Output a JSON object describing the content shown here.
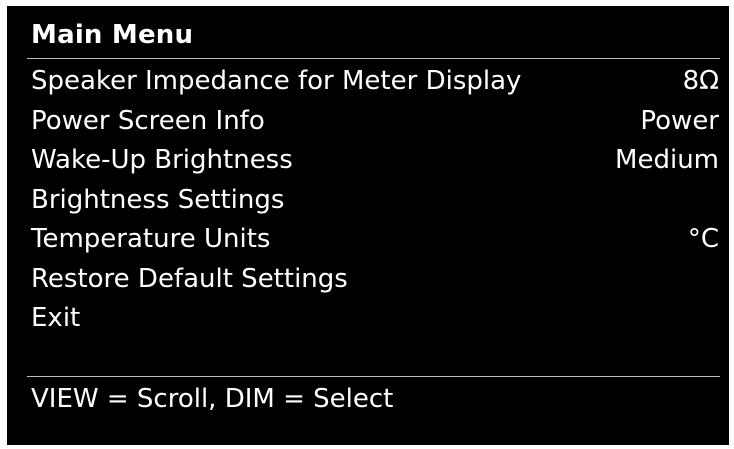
{
  "menu": {
    "title": "Main Menu",
    "items": [
      {
        "label": "Speaker Impedance for Meter Display",
        "value": "8Ω"
      },
      {
        "label": "Power Screen Info",
        "value": "Power"
      },
      {
        "label": "Wake-Up Brightness",
        "value": "Medium"
      },
      {
        "label": "Brightness Settings",
        "value": ""
      },
      {
        "label": "Temperature Units",
        "value": "°C"
      },
      {
        "label": "Restore Default Settings",
        "value": ""
      },
      {
        "label": "Exit",
        "value": ""
      }
    ]
  },
  "footer": {
    "hint": "VIEW = Scroll, DIM = Select"
  },
  "colors": {
    "background": "#000000",
    "text": "#ffffff",
    "divider": "#bdbdbd"
  }
}
